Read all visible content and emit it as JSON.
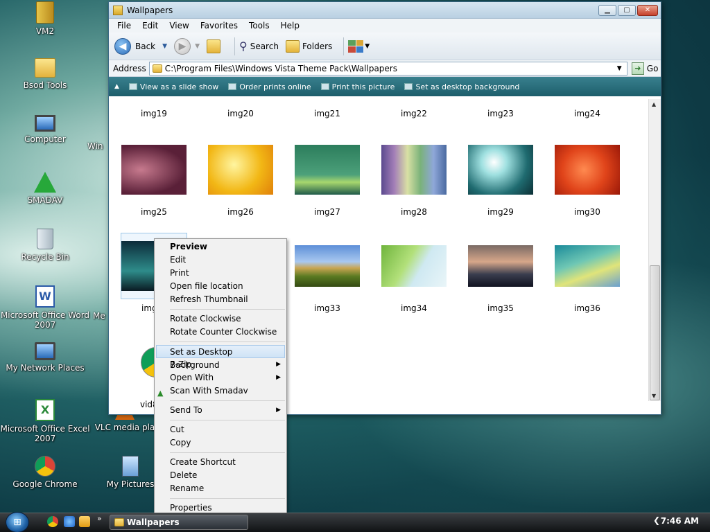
{
  "desktop": {
    "icons": [
      {
        "label": "VM2",
        "icon": "archive-icon"
      },
      {
        "label": "Bsod Tools",
        "icon": "folder-icon"
      },
      {
        "label": "Computer",
        "icon": "computer-icon"
      },
      {
        "label": "SMADAV",
        "icon": "smadav-icon"
      },
      {
        "label": "Recycle Bin",
        "icon": "recycle-bin-icon"
      },
      {
        "label": "Microsoft Office Word 2007",
        "icon": "word-icon"
      },
      {
        "label": "My Network Places",
        "icon": "network-icon"
      },
      {
        "label": "Microsoft Office Excel 2007",
        "icon": "excel-icon"
      },
      {
        "label": "Google Chrome",
        "icon": "chrome-icon"
      }
    ],
    "icons2": [
      {
        "label": "VLC media pla",
        "icon": "vlc-icon"
      },
      {
        "label": "My Pictures",
        "icon": "pictures-icon"
      },
      {
        "label": "Win",
        "icon": "partial-icon"
      },
      {
        "label": "Me",
        "icon": "partial-icon"
      }
    ]
  },
  "window": {
    "title": "Wallpapers",
    "menu": [
      "File",
      "Edit",
      "View",
      "Favorites",
      "Tools",
      "Help"
    ],
    "toolbar": {
      "back": "Back",
      "search": "Search",
      "folders": "Folders"
    },
    "address": {
      "label": "Address",
      "path": "C:\\Program Files\\Windows Vista Theme Pack\\Wallpapers",
      "go": "Go"
    },
    "tasks": [
      "View as a slide show",
      "Order prints online",
      "Print this picture",
      "Set as desktop background"
    ],
    "top_row": [
      "img19",
      "img20",
      "img21",
      "img22",
      "img23",
      "img24"
    ],
    "row2": [
      "img25",
      "img26",
      "img27",
      "img28",
      "img29",
      "img30"
    ],
    "row3": [
      "img",
      "img32",
      "img33",
      "img34",
      "img35",
      "img36"
    ],
    "row4": [
      "vid8"
    ]
  },
  "context_menu": {
    "items": [
      "Preview",
      "Edit",
      "Print",
      "Open file location",
      "Refresh Thumbnail",
      "Rotate Clockwise",
      "Rotate Counter Clockwise",
      "Set as Desktop Background",
      "7-Zip",
      "Open With",
      "Scan With Smadav",
      "Send To",
      "Cut",
      "Copy",
      "Create Shortcut",
      "Delete",
      "Rename",
      "Properties"
    ]
  },
  "taskbar": {
    "active_window": "Wallpapers",
    "clock": "7:46 AM"
  },
  "colors": {
    "highlight": "#cfe3f6",
    "taskpane": "#1d5e6b"
  }
}
